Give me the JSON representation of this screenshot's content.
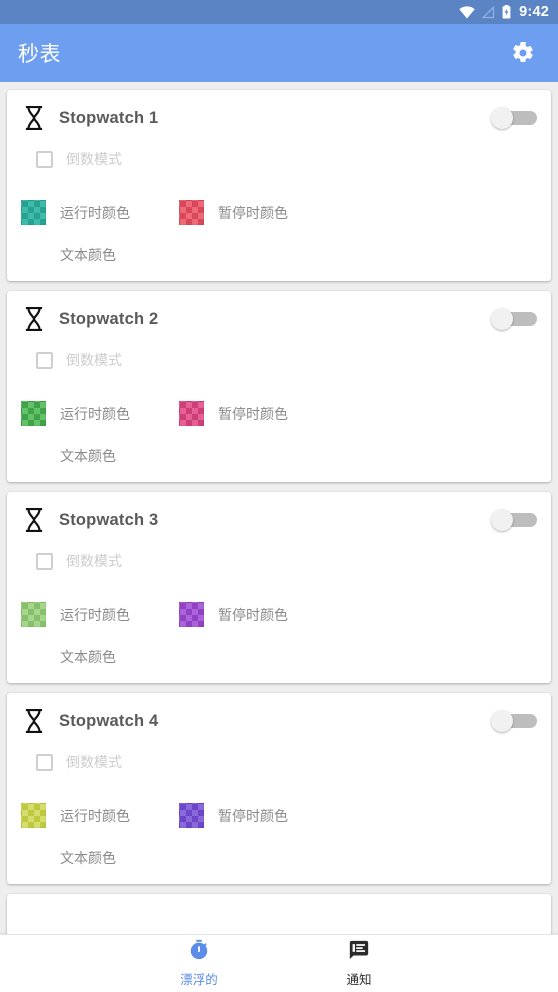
{
  "status_bar": {
    "time": "9:42",
    "icons": [
      "wifi-icon",
      "cellular-signal-icon",
      "battery-charging-icon"
    ],
    "background_color": "#5b84c4"
  },
  "app_bar": {
    "title": "秒表",
    "settings_icon": "gear-icon",
    "background_color": "#6e9ef0",
    "text_color": "#ffffff"
  },
  "cards": [
    {
      "icon": "hourglass-icon",
      "title": "Stopwatch 1",
      "toggle": {
        "state": "off",
        "label": "enable-stopwatch-toggle"
      },
      "checkbox": {
        "label": "倒数模式",
        "checked": false
      },
      "running_color": {
        "label": "运行时颜色",
        "color": "#2aa08f",
        "alt_color": "#3dbcab"
      },
      "paused_color": {
        "label": "暂停时颜色",
        "color": "#d9485a",
        "alt_color": "#ed6b77"
      },
      "text_color": {
        "label": "文本颜色",
        "color": "#ffffff"
      }
    },
    {
      "icon": "hourglass-icon",
      "title": "Stopwatch 2",
      "toggle": {
        "state": "off",
        "label": "enable-stopwatch-toggle"
      },
      "checkbox": {
        "label": "倒数模式",
        "checked": false
      },
      "running_color": {
        "label": "运行时颜色",
        "color": "#3fa347",
        "alt_color": "#63c169"
      },
      "paused_color": {
        "label": "暂停时颜色",
        "color": "#cc3f78",
        "alt_color": "#e76094"
      },
      "text_color": {
        "label": "文本颜色",
        "color": "#ffffff"
      }
    },
    {
      "icon": "hourglass-icon",
      "title": "Stopwatch 3",
      "toggle": {
        "state": "off",
        "label": "enable-stopwatch-toggle"
      },
      "checkbox": {
        "label": "倒数模式",
        "checked": false
      },
      "running_color": {
        "label": "运行时颜色",
        "color": "#86c06a",
        "alt_color": "#a6d68d"
      },
      "paused_color": {
        "label": "暂停时颜色",
        "color": "#9142c4",
        "alt_color": "#ab63d8"
      },
      "text_color": {
        "label": "文本颜色",
        "color": "#ffffff"
      }
    },
    {
      "icon": "hourglass-icon",
      "title": "Stopwatch 4",
      "toggle": {
        "state": "off",
        "label": "enable-stopwatch-toggle"
      },
      "checkbox": {
        "label": "倒数模式",
        "checked": false
      },
      "running_color": {
        "label": "运行时颜色",
        "color": "#bfc93f",
        "alt_color": "#d7dd6d"
      },
      "paused_color": {
        "label": "暂停时颜色",
        "color": "#6b46c8",
        "alt_color": "#8a69da"
      },
      "text_color": {
        "label": "文本颜色",
        "color": "#ffffff"
      }
    }
  ],
  "bottom_nav": {
    "items": [
      {
        "label": "漂浮的",
        "icon": "stopwatch-icon",
        "active": true,
        "color": "#5b8ce8"
      },
      {
        "label": "通知",
        "icon": "notification-message-icon",
        "active": false,
        "color": "#2b2b2b"
      }
    ]
  }
}
